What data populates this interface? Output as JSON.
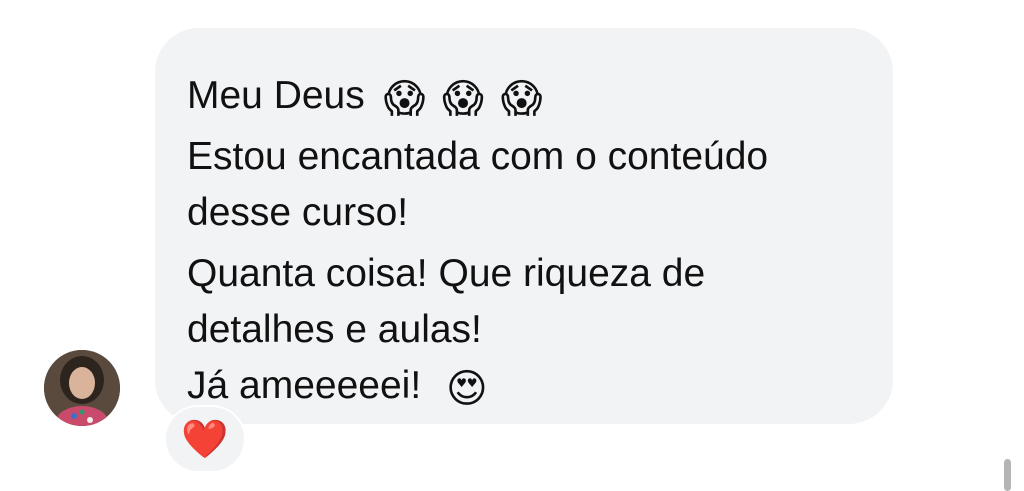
{
  "message": {
    "line1_text": "Meu Deus",
    "line1_emojis": [
      "😱",
      "😱",
      "😱"
    ],
    "paragraph2": [
      "Estou encantada com o conteúdo",
      "desse curso!"
    ],
    "paragraph3": [
      "Quanta coisa! Que riqueza de",
      "detalhes e aulas!"
    ],
    "line_last_text": "Já ameeeeei!",
    "line_last_emoji": "😍"
  },
  "reaction": {
    "emoji": "❤️",
    "icon": "heart-icon",
    "color": "#e0182a"
  },
  "avatar": {
    "icon": "user-avatar"
  },
  "colors": {
    "bubble": "#f2f3f5",
    "text": "#111111",
    "background": "#ffffff"
  }
}
